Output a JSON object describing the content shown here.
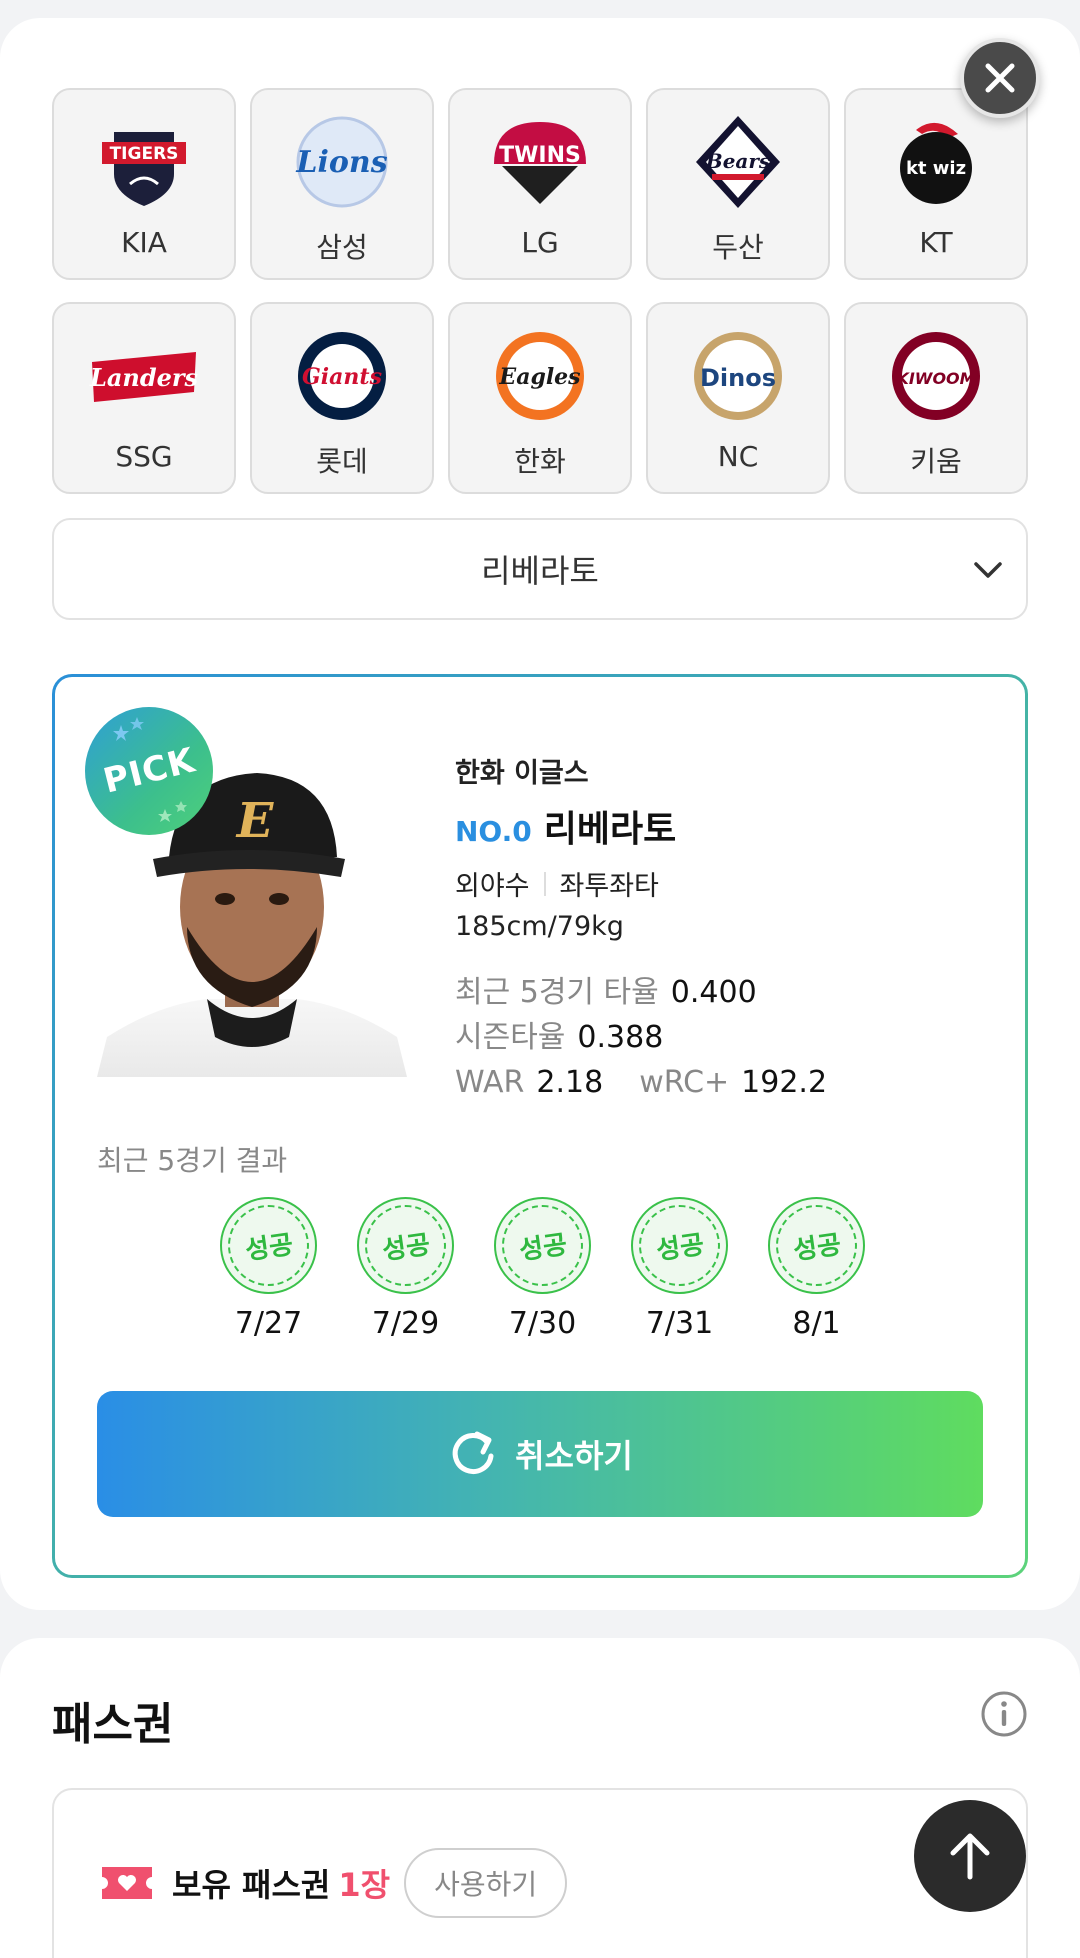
{
  "teams": [
    {
      "name": "KIA",
      "logo": "tigers-logo",
      "logo_text": "TIGERS"
    },
    {
      "name": "삼성",
      "logo": "lions-logo",
      "logo_text": "Lions"
    },
    {
      "name": "LG",
      "logo": "twins-logo",
      "logo_text": "TWINS"
    },
    {
      "name": "두산",
      "logo": "bears-logo",
      "logo_text": "Bears"
    },
    {
      "name": "KT",
      "logo": "ktwiz-logo",
      "logo_text": "kt wiz"
    },
    {
      "name": "SSG",
      "logo": "landers-logo",
      "logo_text": "Landers"
    },
    {
      "name": "롯데",
      "logo": "giants-logo",
      "logo_text": "Giants"
    },
    {
      "name": "한화",
      "logo": "eagles-logo",
      "logo_text": "Eagles"
    },
    {
      "name": "NC",
      "logo": "dinos-logo",
      "logo_text": "Dinos"
    },
    {
      "name": "키움",
      "logo": "kiwoom-logo",
      "logo_text": "KIWOOM"
    }
  ],
  "player_select": {
    "value": "리베라토"
  },
  "pick": {
    "badge": "PICK",
    "team": "한화 이글스",
    "number": "NO.0",
    "name": "리베라토",
    "position": "외야수",
    "bats_throws": "좌투좌타",
    "body": "185cm/79kg",
    "stats": {
      "recent5_label": "최근 5경기 타율",
      "recent5_value": "0.400",
      "season_label": "시즌타율",
      "season_value": "0.388",
      "war_label": "WAR",
      "war_value": "2.18",
      "wrc_label": "wRC+",
      "wrc_value": "192.2"
    },
    "recent_title": "최근 5경기 결과",
    "results": [
      {
        "status": "성공",
        "date": "7/27"
      },
      {
        "status": "성공",
        "date": "7/29"
      },
      {
        "status": "성공",
        "date": "7/30"
      },
      {
        "status": "성공",
        "date": "7/31"
      },
      {
        "status": "성공",
        "date": "8/1"
      }
    ],
    "cancel_label": "취소하기"
  },
  "pass": {
    "title": "패스권",
    "owned_label": "보유 패스권",
    "owned_count": "1장",
    "use_label": "사용하기"
  },
  "colors": {
    "accent_blue": "#2a8fe0",
    "accent_green": "#5fdc5f",
    "success": "#2fb83f",
    "pass_count": "#f0506e"
  },
  "icons": [
    "close-icon",
    "chevron-down-icon",
    "refresh-icon",
    "info-icon",
    "ticket-icon",
    "arrow-up-icon"
  ]
}
